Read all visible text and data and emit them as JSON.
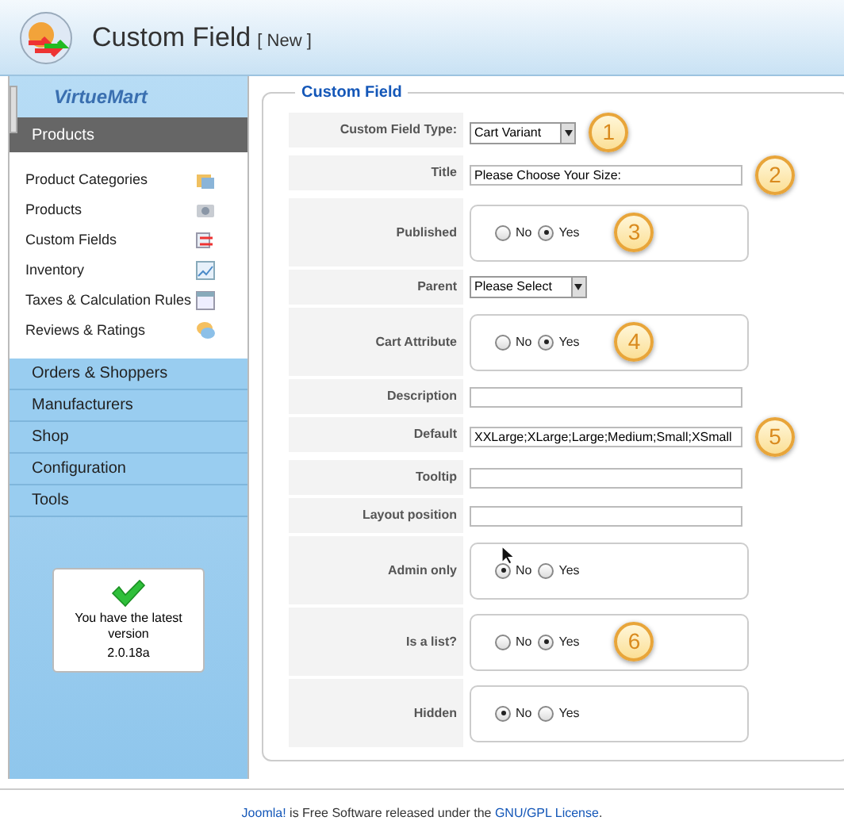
{
  "header": {
    "title": "Custom Field",
    "status": "[ New ]"
  },
  "sidebar": {
    "logo": "VirtueMart",
    "section": "Products",
    "items": [
      {
        "label": "Product Categories"
      },
      {
        "label": "Products"
      },
      {
        "label": "Custom Fields"
      },
      {
        "label": "Inventory"
      },
      {
        "label": "Taxes & Calculation Rules"
      },
      {
        "label": "Reviews & Ratings"
      }
    ],
    "menu": [
      "Orders & Shoppers",
      "Manufacturers",
      "Shop",
      "Configuration",
      "Tools"
    ],
    "version_box": {
      "message": "You have the latest version",
      "version": "2.0.18a"
    }
  },
  "form": {
    "legend": "Custom Field",
    "rows": [
      {
        "label": "Custom Field Type:",
        "kind": "select",
        "value": "Cart Variant",
        "callout": "1"
      },
      {
        "label": "Title",
        "kind": "text",
        "value": "Please Choose Your Size:",
        "callout": "2"
      },
      {
        "label": "Published",
        "kind": "radio",
        "options": [
          {
            "label": "No",
            "selected": false
          },
          {
            "label": "Yes",
            "selected": true
          }
        ],
        "callout": "3"
      },
      {
        "label": "Parent",
        "kind": "select",
        "value": "Please Select"
      },
      {
        "label": "Cart Attribute",
        "kind": "radio",
        "options": [
          {
            "label": "No",
            "selected": false
          },
          {
            "label": "Yes",
            "selected": true
          }
        ],
        "callout": "4"
      },
      {
        "label": "Description",
        "kind": "text"
      },
      {
        "label": "Default",
        "kind": "text",
        "value": "XXLarge;XLarge;Large;Medium;Small;XSmall",
        "callout": "5"
      },
      {
        "label": "Tooltip",
        "kind": "text"
      },
      {
        "label": "Layout position",
        "kind": "text"
      },
      {
        "label": "Admin only",
        "kind": "radio",
        "options": [
          {
            "label": "No",
            "selected": true
          },
          {
            "label": "Yes",
            "selected": false
          }
        ],
        "pointer": true
      },
      {
        "label": "Is a list?",
        "kind": "radio",
        "options": [
          {
            "label": "No",
            "selected": false
          },
          {
            "label": "Yes",
            "selected": true
          }
        ],
        "callout": "6"
      },
      {
        "label": "Hidden",
        "kind": "radio",
        "options": [
          {
            "label": "No",
            "selected": true
          },
          {
            "label": "Yes",
            "selected": false
          }
        ]
      }
    ]
  },
  "footer": {
    "text": "**Joomla!** is Free Software released under the **GNU/GPL License**."
  }
}
